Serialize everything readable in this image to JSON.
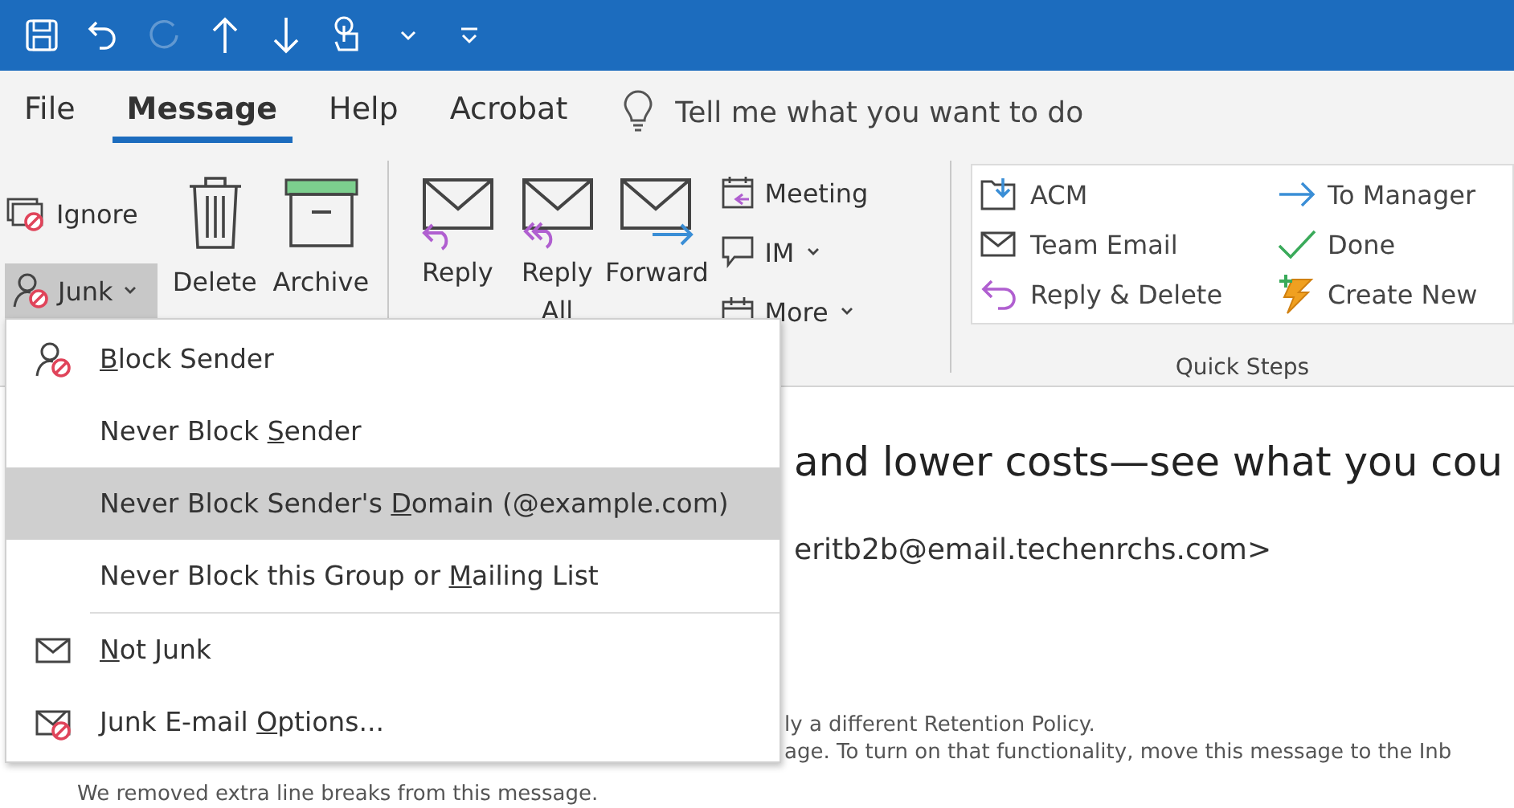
{
  "quick_access": [
    {
      "kind": "save",
      "disabled": false
    },
    {
      "kind": "undo",
      "disabled": false
    },
    {
      "kind": "redo",
      "disabled": true
    },
    {
      "kind": "up",
      "disabled": false
    },
    {
      "kind": "down",
      "disabled": false
    },
    {
      "kind": "touch",
      "disabled": false
    },
    {
      "kind": "touch_menu",
      "disabled": false
    },
    {
      "kind": "customize",
      "disabled": false
    }
  ],
  "tabs": [
    {
      "label": "File",
      "selected": false
    },
    {
      "label": "Message",
      "selected": true
    },
    {
      "label": "Help",
      "selected": false
    },
    {
      "label": "Acrobat",
      "selected": false
    }
  ],
  "tell_me": {
    "placeholder": "Tell me what you want to do"
  },
  "ribbon": {
    "small_left": [
      {
        "kind": "ignore",
        "label": "Ignore",
        "pressed": false,
        "dropdown": false
      },
      {
        "kind": "junk",
        "label": "Junk",
        "pressed": true,
        "dropdown": true
      }
    ],
    "delete_group": [
      {
        "kind": "delete",
        "label": "Delete"
      },
      {
        "kind": "archive",
        "label": "Archive"
      }
    ],
    "respond_large": [
      {
        "kind": "reply",
        "label": "Reply"
      },
      {
        "kind": "reply_all",
        "label": "Reply All"
      },
      {
        "kind": "forward",
        "label": "Forward"
      }
    ],
    "respond_small": [
      {
        "kind": "meeting",
        "label": "Meeting",
        "dropdown": false
      },
      {
        "kind": "im",
        "label": "IM",
        "dropdown": true
      },
      {
        "kind": "more",
        "label": "More",
        "dropdown": true
      }
    ],
    "quick_steps": {
      "label": "Quick Steps",
      "items": [
        {
          "kind": "acm",
          "label": "ACM"
        },
        {
          "kind": "to_manager",
          "label": "To Manager"
        },
        {
          "kind": "team_email",
          "label": "Team Email"
        },
        {
          "kind": "done",
          "label": "Done"
        },
        {
          "kind": "reply_delete",
          "label": "Reply & Delete"
        },
        {
          "kind": "create_new",
          "label": "Create New"
        }
      ]
    }
  },
  "junk_menu": [
    {
      "kind": "block",
      "key": "B",
      "after": "lock Sender",
      "selected": false,
      "separator_after": false
    },
    {
      "kind": "plain",
      "before": "Never Block ",
      "key": "S",
      "after": "ender",
      "selected": false,
      "separator_after": false
    },
    {
      "kind": "plain",
      "before": "Never Block Sender's ",
      "key": "D",
      "after": "omain (@example.com)",
      "selected": true,
      "separator_after": false
    },
    {
      "kind": "plain",
      "before": "Never Block this Group or ",
      "key": "M",
      "after": "ailing List",
      "selected": false,
      "separator_after": true
    },
    {
      "kind": "not_junk",
      "key": "N",
      "after": "ot Junk",
      "selected": false,
      "separator_after": false
    },
    {
      "kind": "options",
      "before": "Junk E-mail ",
      "key": "O",
      "after": "ptions...",
      "selected": false,
      "separator_after": false
    }
  ],
  "message": {
    "subject": "and lower costs—see what you cou",
    "sender": "eritb2b@email.techenrchs.com>",
    "info": [
      "ly a different Retention Policy.",
      "age. To turn on that functionality, move this message to the Inb"
    ],
    "note": "We removed extra line breaks from this message."
  }
}
